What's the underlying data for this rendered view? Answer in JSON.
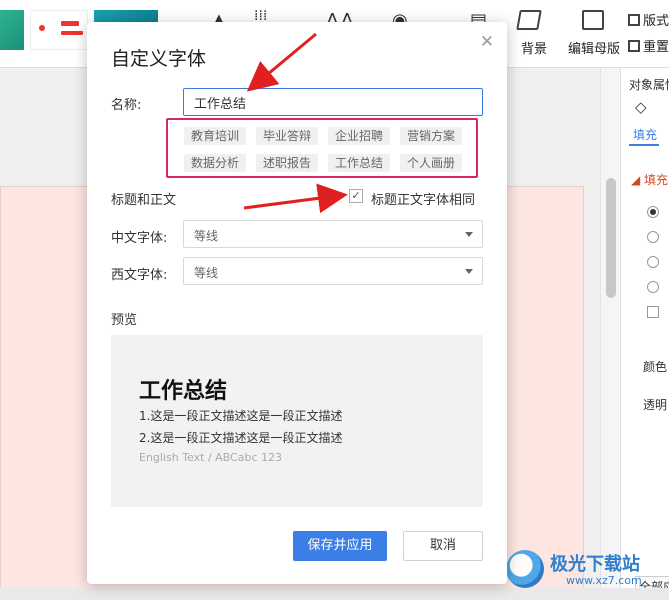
{
  "toolbar": {
    "background_label": "背景",
    "edit_master_label": "编辑母版",
    "version_label": "版式",
    "reset_label": "重置"
  },
  "side_panel": {
    "title": "对象属性",
    "tab_fill": "填充",
    "section_fill": "填充",
    "color_label": "颜色",
    "transparency_label": "透明",
    "apply_all_label": "全部应"
  },
  "dialog": {
    "title": "自定义字体",
    "name_label": "名称:",
    "name_value": "工作总结",
    "presets": [
      "教育培训",
      "毕业答辩",
      "企业招聘",
      "营销方案",
      "数据分析",
      "述职报告",
      "工作总结",
      "个人画册"
    ],
    "title_body_label": "标题和正文",
    "same_font_label": "标题正文字体相同",
    "same_font_checked": true,
    "cn_font_label": "中文字体:",
    "cn_font_value": "等线",
    "en_font_label": "西文字体:",
    "en_font_value": "等线",
    "preview_label": "预览",
    "preview": {
      "title": "工作总结",
      "line1": "1.这是一段正文描述这是一段正文描述",
      "line2": "2.这是一段正文描述这是一段正文描述",
      "english": "English Text / ABCabc 123"
    },
    "save_button": "保存并应用",
    "cancel_button": "取消"
  },
  "watermark": {
    "title": "极光下载站",
    "url": "www.xz7.com"
  },
  "colors": {
    "accent": "#3b7ee6",
    "highlight_box": "#d8266b",
    "annotation_arrow": "#e02020",
    "slide": "#fde6e1"
  }
}
